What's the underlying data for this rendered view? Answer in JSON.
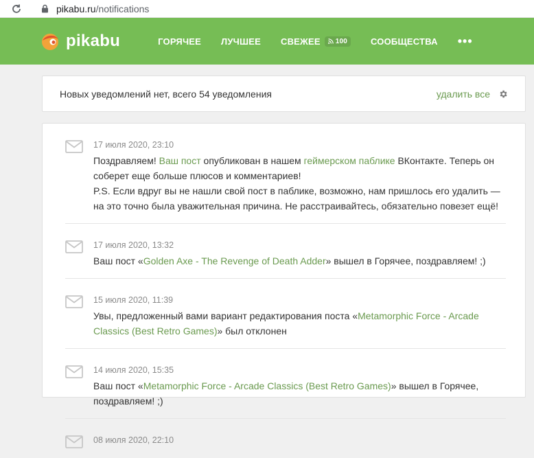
{
  "browser": {
    "url_host": "pikabu.ru",
    "url_path": "/notifications"
  },
  "header": {
    "logo_text": "pikabu",
    "nav": {
      "hot": "ГОРЯЧЕЕ",
      "best": "ЛУЧШЕЕ",
      "fresh": "СВЕЖЕЕ",
      "fresh_badge": "100",
      "communities": "СООБЩЕСТВА",
      "more": "•••"
    },
    "colors": {
      "header_bg": "#76bd55",
      "link": "#6a9a4f"
    }
  },
  "summary": {
    "text": "Новых уведомлений нет, всего 54 уведомления",
    "delete_all": "удалить все"
  },
  "notifications": [
    {
      "date": "17 июля 2020, 23:10",
      "t1": "Поздравляем! ",
      "l1": "Ваш пост",
      "t2": " опубликован в нашем ",
      "l2": "геймерском паблике",
      "t3": " ВКонтакте. Теперь он соберет еще больше плюсов и комментариев!",
      "t4": "P.S. Если вдруг вы не нашли свой пост в паблике, возможно, нам пришлось его удалить — на это точно была уважительная причина. Не расстраивайтесь, обязательно повезет ещё!"
    },
    {
      "date": "17 июля 2020, 13:32",
      "t1": "Ваш пост «",
      "l1": "Golden Axe - The Revenge of Death Adder",
      "t2": "» вышел в Горячее, поздравляем! ;)"
    },
    {
      "date": "15 июля 2020, 11:39",
      "t1": "Увы, предложенный вами вариант редактирования поста «",
      "l1": "Metamorphic Force - Arcade Classics (Best Retro Games)",
      "t2": "» был отклонен"
    },
    {
      "date": "14 июля 2020, 15:35",
      "t1": "Ваш пост «",
      "l1": "Metamorphic Force - Arcade Classics (Best Retro Games)",
      "t2": "» вышел в Горячее, поздравляем! ;)"
    },
    {
      "date": "08 июля 2020, 22:10"
    }
  ]
}
